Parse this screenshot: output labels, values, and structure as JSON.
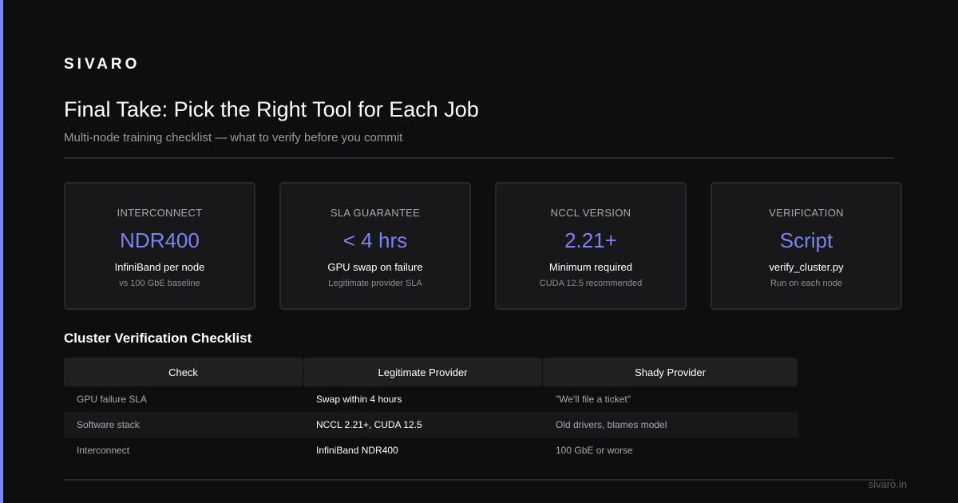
{
  "brand": "SIVARO",
  "header": {
    "title": "Final Take: Pick the Right Tool for Each Job",
    "subtitle": "Multi-node training checklist — what to verify before you commit"
  },
  "cards": [
    {
      "label": "INTERCONNECT",
      "value": "NDR400",
      "desc": "InfiniBand per node",
      "note": "vs 100 GbE baseline"
    },
    {
      "label": "SLA GUARANTEE",
      "value": "< 4 hrs",
      "desc": "GPU swap on failure",
      "note": "Legitimate provider SLA"
    },
    {
      "label": "NCCL VERSION",
      "value": "2.21+",
      "desc": "Minimum required",
      "note": "CUDA 12.5 recommended"
    },
    {
      "label": "VERIFICATION",
      "value": "Script",
      "desc": "verify_cluster.py",
      "note": "Run on each node"
    }
  ],
  "checklist": {
    "title": "Cluster Verification Checklist",
    "headers": [
      "Check",
      "Legitimate Provider",
      "Shady Provider"
    ],
    "rows": [
      [
        "GPU failure SLA",
        "Swap within 4 hours",
        "\"We'll file a ticket\""
      ],
      [
        "Software stack",
        "NCCL 2.21+, CUDA 12.5",
        "Old drivers, blames model"
      ],
      [
        "Interconnect",
        "InfiniBand NDR400",
        "100 GbE or worse"
      ]
    ]
  },
  "footer": {
    "link": "sivaro.in"
  },
  "colors": {
    "accent": "#7b84f2",
    "background": "#0e0e0f",
    "card": "#18181b"
  }
}
